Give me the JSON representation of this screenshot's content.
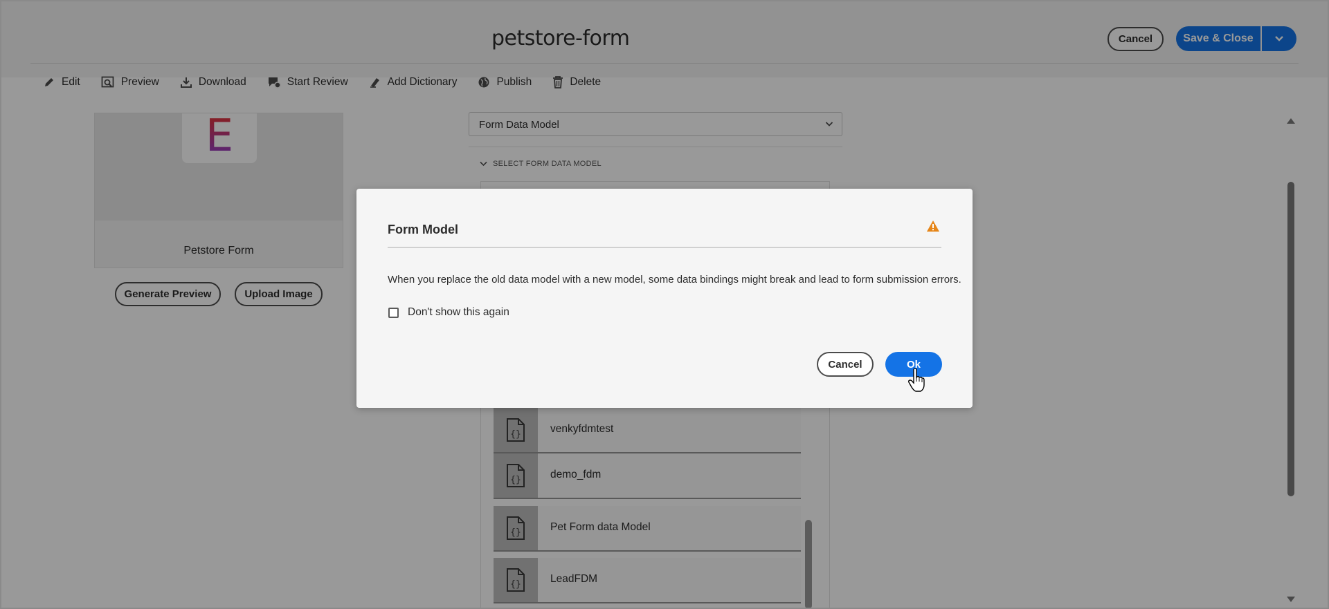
{
  "header": {
    "title": "petstore-form",
    "cancel_label": "Cancel",
    "save_close_label": "Save & Close"
  },
  "toolbar": {
    "items": [
      {
        "label": "Edit",
        "icon": "pencil-icon"
      },
      {
        "label": "Preview",
        "icon": "preview-icon"
      },
      {
        "label": "Download",
        "icon": "download-icon"
      },
      {
        "label": "Start Review",
        "icon": "review-icon"
      },
      {
        "label": "Add Dictionary",
        "icon": "dictionary-icon"
      },
      {
        "label": "Publish",
        "icon": "globe-icon"
      },
      {
        "label": "Delete",
        "icon": "trash-icon"
      }
    ]
  },
  "thumbnail": {
    "letter": "E",
    "label": "Petstore Form",
    "generate_preview_label": "Generate Preview",
    "upload_image_label": "Upload Image"
  },
  "form_model": {
    "select_value": "Form Data Model",
    "section_label": "SELECT FORM DATA MODEL",
    "items": [
      {
        "label": "venkyfdmtest"
      },
      {
        "label": "demo_fdm"
      },
      {
        "label": "Pet Form data Model"
      },
      {
        "label": "LeadFDM"
      }
    ]
  },
  "dialog": {
    "title": "Form Model",
    "message": "When you replace the old data model with a new model, some data bindings might break and lead to form submission errors.",
    "checkbox_label": "Don't show this again",
    "checkbox_checked": false,
    "cancel_label": "Cancel",
    "ok_label": "Ok"
  },
  "colors": {
    "accent": "#1473e6",
    "warning": "#e68619"
  }
}
